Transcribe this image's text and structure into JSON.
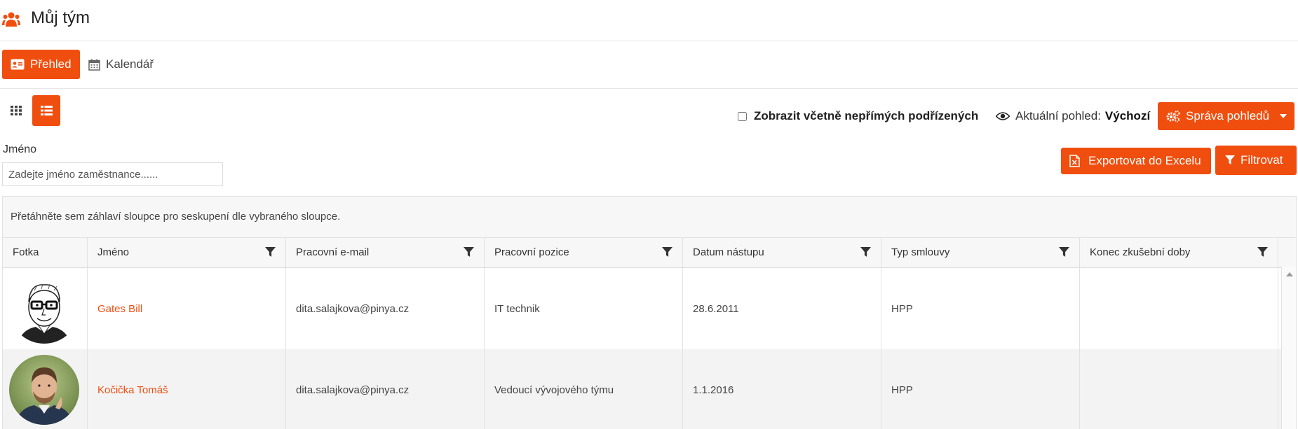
{
  "page": {
    "title": "Můj tým",
    "icon": "users-icon"
  },
  "tabs": [
    {
      "label": "Přehled",
      "icon": "id-card-icon",
      "active": true
    },
    {
      "label": "Kalendář",
      "icon": "calendar-icon",
      "active": false
    }
  ],
  "toolbar": {
    "indirect_label": "Zobrazit včetně nepřímých podřízených",
    "indirect_checked": false,
    "current_view_label": "Aktuální pohled:",
    "current_view_value": "Výchozí",
    "manage_views_label": "Správa pohledů",
    "export_label": "Exportovat do Excelu",
    "filter_label": "Filtrovat"
  },
  "filters": {
    "name_label": "Jméno",
    "name_placeholder": "Zadejte jméno zaměstnance......",
    "name_value": ""
  },
  "grid": {
    "group_hint": "Přetáhněte sem záhlaví sloupce pro seskupení dle vybraného sloupce.",
    "columns": [
      "Fotka",
      "Jméno",
      "Pracovní e-mail",
      "Pracovní pozice",
      "Datum nástupu",
      "Typ smlouvy",
      "Konec zkušební doby"
    ],
    "rows": [
      {
        "name": "Gates Bill",
        "email": "dita.salajkova@pinya.cz",
        "position": "IT technik",
        "start": "28.6.2011",
        "contract": "HPP",
        "probation_end": ""
      },
      {
        "name": "Kočička Tomáš",
        "email": "dita.salajkova@pinya.cz",
        "position": "Vedoucí vývojového týmu",
        "start": "1.1.2016",
        "contract": "HPP",
        "probation_end": ""
      }
    ]
  },
  "colors": {
    "accent": "#f04e0e"
  }
}
